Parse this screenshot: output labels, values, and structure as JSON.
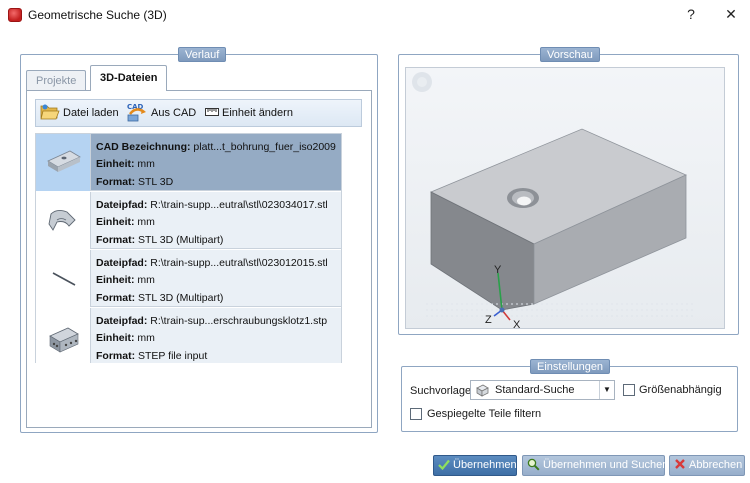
{
  "window": {
    "title": "Geometrische Suche (3D)",
    "help_label": "?",
    "close_label": "✕"
  },
  "history": {
    "caption": "Verlauf",
    "tabs": [
      {
        "label": "Projekte"
      },
      {
        "label": "3D-Dateien"
      }
    ],
    "toolbar": {
      "load_label": "Datei laden",
      "cad_label": "Aus CAD",
      "cad_icon_text": "CAD",
      "unit_label": "Einheit ändern"
    },
    "files": [
      {
        "key": "CAD Bezeichnung:",
        "value": " platt...t_bohrung_fuer_iso2009",
        "unit_key": "Einheit:",
        "unit": " mm",
        "format_key": "Format:",
        "format": " STL 3D",
        "icon": "plate-thumbnail-icon"
      },
      {
        "key": "Dateipfad:",
        "value": " R:\\train-supp...eutral\\stl\\023034017.stl",
        "unit_key": "Einheit:",
        "unit": " mm",
        "format_key": "Format:",
        "format": " STL 3D (Multipart)",
        "icon": "bracket-thumbnail-icon"
      },
      {
        "key": "Dateipfad:",
        "value": " R:\\train-supp...eutral\\stl\\023012015.stl",
        "unit_key": "Einheit:",
        "unit": " mm",
        "format_key": "Format:",
        "format": " STL 3D (Multipart)",
        "icon": "pin-thumbnail-icon"
      },
      {
        "key": "Dateipfad:",
        "value": " R:\\train-sup...erschraubungsklotz1.stp",
        "unit_key": "Einheit:",
        "unit": " mm",
        "format_key": "Format:",
        "format": " STEP file input",
        "icon": "block-thumbnail-icon"
      }
    ]
  },
  "preview": {
    "caption": "Vorschau",
    "axes": {
      "y": "Y",
      "z": "Z",
      "x": "X"
    }
  },
  "settings": {
    "caption": "Einstellungen",
    "template_label": "Suchvorlage:",
    "template_value": "Standard-Suche",
    "size_dependent_label": "Größenabhängig",
    "size_dependent_checked": false,
    "mirrored_label": "Gespiegelte Teile filtern",
    "mirrored_checked": false
  },
  "buttons": {
    "apply": "Übernehmen",
    "apply_search": "Übernehmen und Suchen",
    "cancel": "Abbrechen"
  },
  "colors": {
    "accent": "#3e6fa6",
    "selected_row": "#95abc4",
    "group_border": "#8fa6c2"
  }
}
